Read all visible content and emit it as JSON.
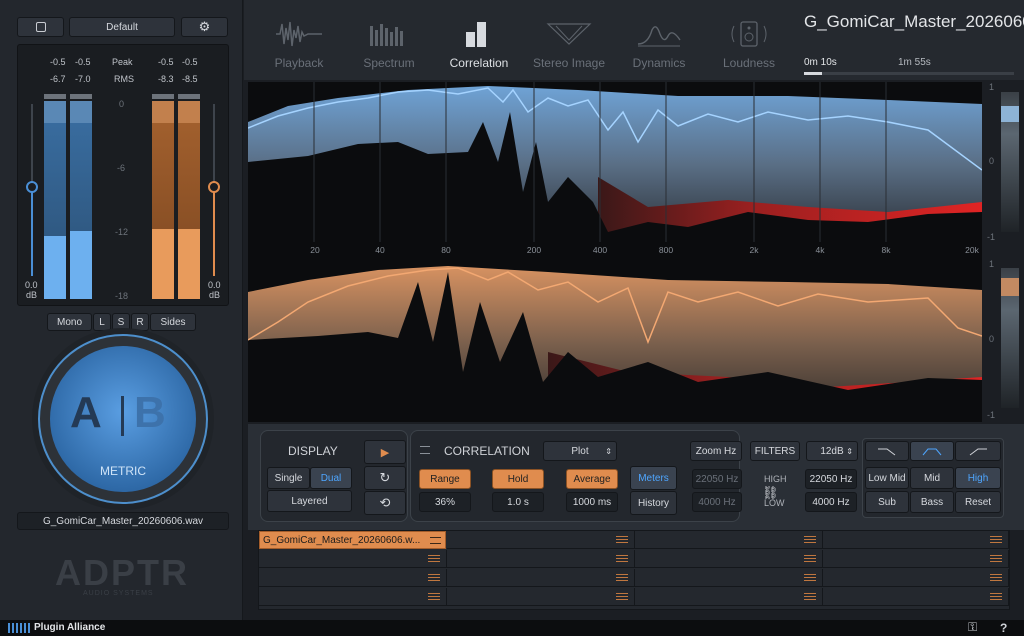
{
  "left": {
    "preset": "Default",
    "peak_label": "Peak",
    "rms_label": "RMS",
    "peak_left": [
      "-0.5",
      "-0.5"
    ],
    "peak_right": [
      "-0.5",
      "-0.5"
    ],
    "rms_left": [
      "-6.7",
      "-7.0"
    ],
    "rms_right": [
      "-8.3",
      "-8.5"
    ],
    "scale": [
      "0",
      "-6",
      "-12",
      "-18"
    ],
    "gain_left_value": "0.0",
    "gain_right_value": "0.0",
    "gain_unit": "dB",
    "channels": [
      "Mono",
      "L",
      "S",
      "R",
      "Sides"
    ],
    "ab_a": "A",
    "ab_b": "B",
    "ab_caption": "METRIC",
    "file": "G_GomiCar_Master_20260606.wav",
    "logo": "ADPTR",
    "logo_sub": "AUDIO SYSTEMS",
    "colors": {
      "accent_blue": "#4a8fd6",
      "accent_orange": "#e08c4e",
      "panel": "#2a2f36"
    }
  },
  "tabs": [
    {
      "label": "Playback",
      "icon": "playback-wave-icon",
      "active": false
    },
    {
      "label": "Spectrum",
      "icon": "spectrum-bars-icon",
      "active": false
    },
    {
      "label": "Correlation",
      "icon": "correlation-bars-icon",
      "active": true
    },
    {
      "label": "Stereo Image",
      "icon": "stereo-image-icon",
      "active": false
    },
    {
      "label": "Dynamics",
      "icon": "dynamics-icon",
      "active": false
    },
    {
      "label": "Loudness",
      "icon": "loudness-speaker-icon",
      "active": false
    }
  ],
  "header": {
    "file_title": "G_GomiCar_Master_2026060...",
    "time_start": "0m 10s",
    "time_end": "1m 55s"
  },
  "graph": {
    "freq_labels": [
      "20",
      "40",
      "80",
      "200",
      "400",
      "800",
      "2k",
      "4k",
      "8k",
      "20k"
    ],
    "right_scale_top": [
      "1",
      "0",
      "-1"
    ],
    "right_scale_bottom": [
      "1",
      "0",
      "-1"
    ]
  },
  "controls": {
    "display_title": "DISPLAY",
    "display_single": "Single",
    "display_dual": "Dual",
    "display_layered": "Layered",
    "correlation_title": "CORRELATION",
    "plot_select": "Plot",
    "range_label": "Range",
    "range_value": "36%",
    "hold_label": "Hold",
    "hold_value": "1.0 s",
    "average_label": "Average",
    "average_value": "1000 ms",
    "meters": "Meters",
    "history": "History",
    "zoom_hz": "Zoom Hz",
    "filters": "FILTERS",
    "slope": "12dB",
    "high_left": "22050 Hz",
    "low_left": "4000 Hz",
    "high_right": "22050 Hz",
    "low_right": "4000 Hz",
    "high_label": "HIGH",
    "low_label": "LOW",
    "band_low_mid": "Low Mid",
    "band_mid": "Mid",
    "band_high": "High",
    "band_sub": "Sub",
    "band_bass": "Bass",
    "band_reset": "Reset"
  },
  "slots": {
    "active_file": "G_GomiCar_Master_20260606.w..."
  },
  "footer": {
    "brand": "Plugin Alliance",
    "help": "?"
  }
}
